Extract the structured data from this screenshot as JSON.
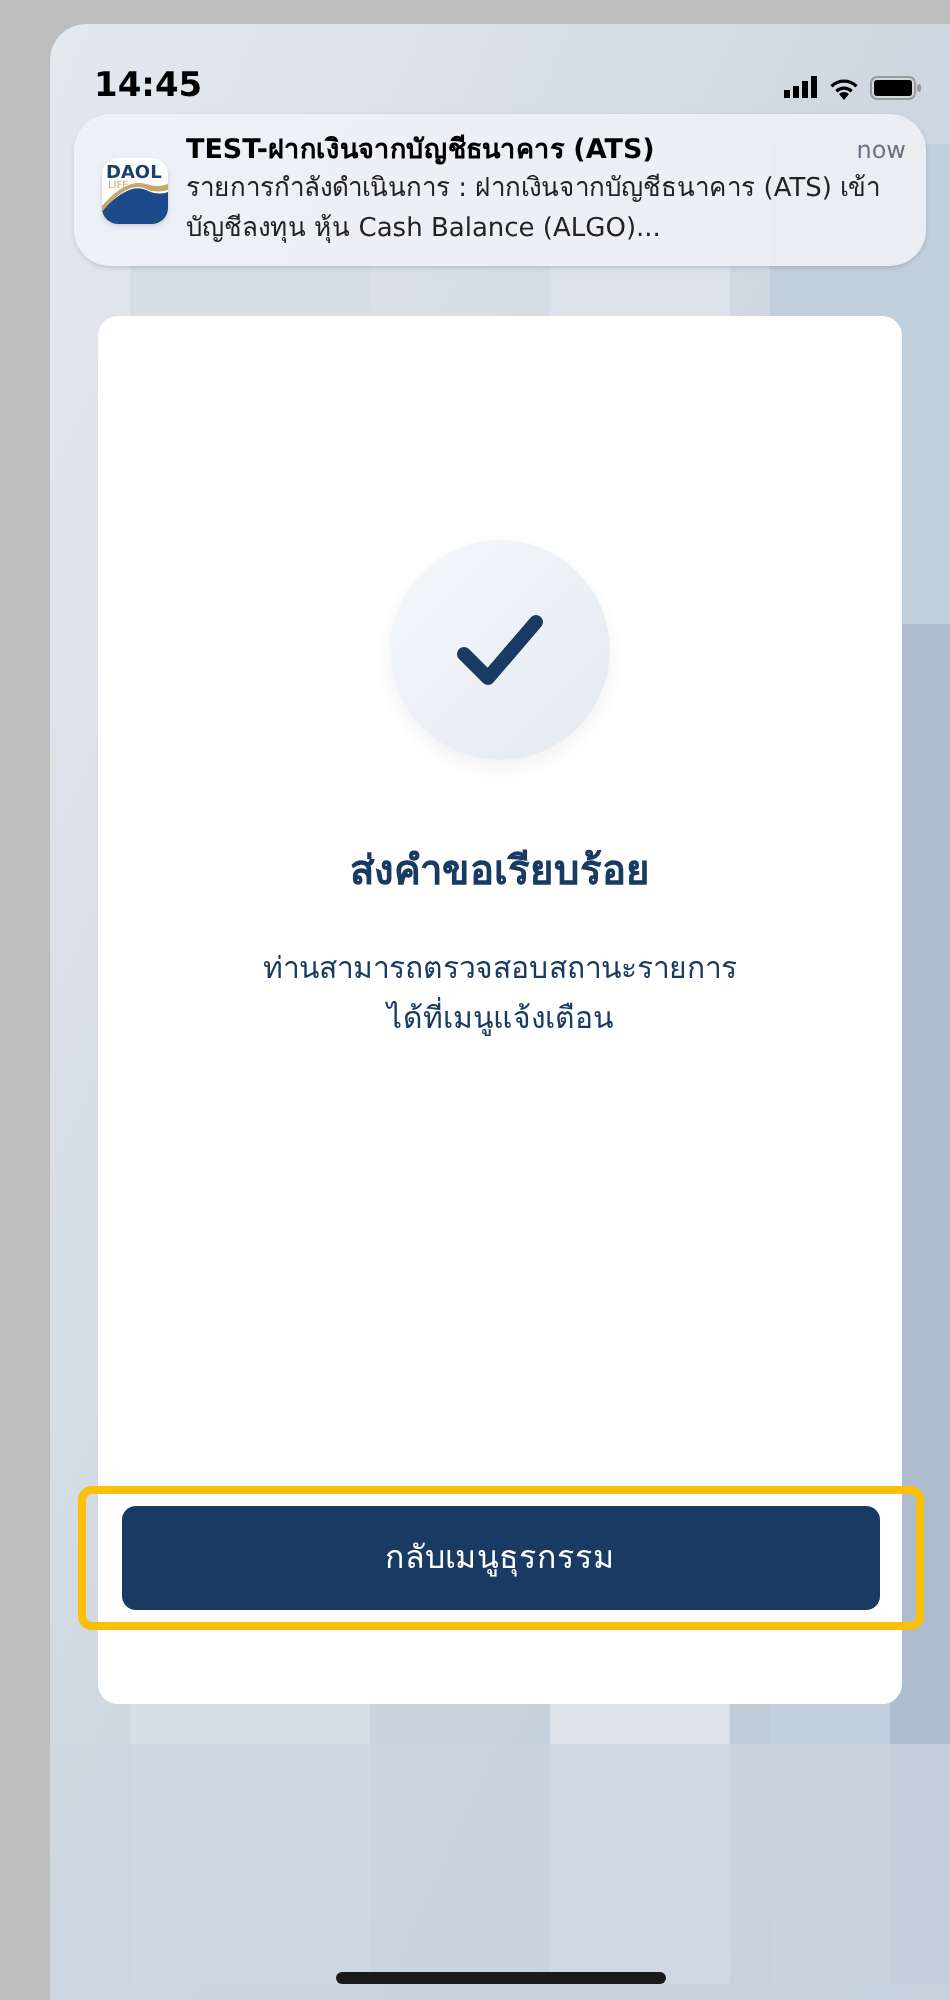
{
  "status_bar": {
    "time": "14:45"
  },
  "notification": {
    "logo": {
      "name": "DAOL",
      "sub": "LIFE"
    },
    "title": "TEST-ฝากเงินจากบัญชีธนาคาร (ATS)",
    "time": "now",
    "body": "รายการกำลังดำเนินการ : ฝากเงินจากบัญชีธนาคาร (ATS) เข้าบัญชีลงทุน หุ้น Cash Balance (ALGO)..."
  },
  "result": {
    "title": "ส่งคำขอเรียบร้อย",
    "message_lines": [
      "ท่านสามารถตรวจสอบสถานะรายการ",
      "ได้ที่เมนูแจ้งเตือน"
    ]
  },
  "button": {
    "label": "กลับเมนูธุรกรรม",
    "highlighted": true
  }
}
